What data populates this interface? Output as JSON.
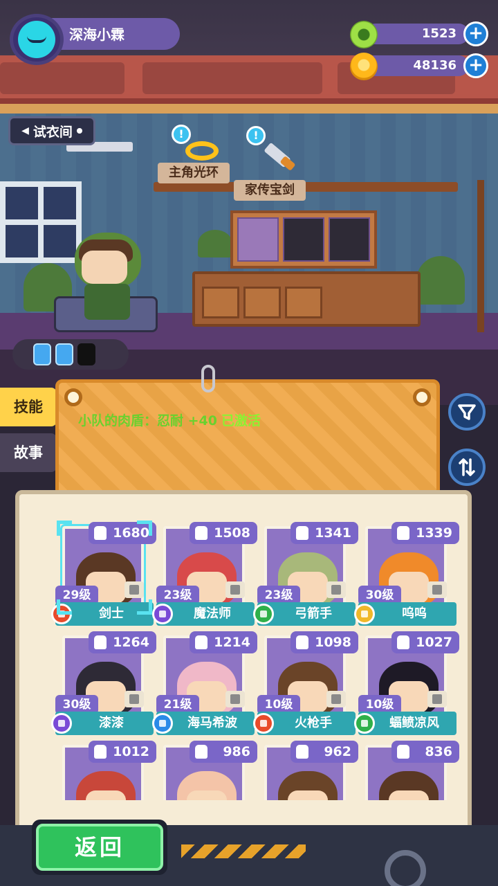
{
  "player": {
    "name": "深海小霖"
  },
  "currencies": [
    {
      "icon": "green-donut-currency-icon",
      "amount": "1523"
    },
    {
      "icon": "gold-planet-coin-icon",
      "amount": "48136"
    }
  ],
  "room": {
    "fitting_room_label": "试衣间",
    "halo_label": "主角光环",
    "sword_label": "家传宝剑",
    "alert_glyph": "!"
  },
  "side_tabs": [
    {
      "label": "技能",
      "active": true
    },
    {
      "label": "故事",
      "active": false
    }
  ],
  "info_board": {
    "skill_text": "小队的肉盾：忍耐 +40",
    "status_text": "已激活"
  },
  "characters": [
    {
      "name": "剑士",
      "level": "29级",
      "power": "1680",
      "class_color": "#e84a2a",
      "hair": "#5a3824",
      "bg": "#8e74c4",
      "selected": true
    },
    {
      "name": "魔法师",
      "level": "23级",
      "power": "1508",
      "class_color": "#7a4ad6",
      "hair": "#d84a4a",
      "bg": "#8e74c4",
      "selected": false
    },
    {
      "name": "弓箭手",
      "level": "23级",
      "power": "1341",
      "class_color": "#2fb04a",
      "hair": "#a8b87a",
      "bg": "#8e74c4",
      "selected": false
    },
    {
      "name": "呜呜",
      "level": "30级",
      "power": "1339",
      "class_color": "#f0b82a",
      "hair": "#f08a2a",
      "bg": "#8e74c4",
      "selected": false
    },
    {
      "name": "漆漆",
      "level": "30级",
      "power": "1264",
      "class_color": "#7a4ad6",
      "hair": "#2e2a36",
      "bg": "#8e74c4",
      "selected": false
    },
    {
      "name": "海马希波",
      "level": "21级",
      "power": "1214",
      "class_color": "#2a8ae8",
      "hair": "#f0b8c8",
      "bg": "#8e74c4",
      "selected": false
    },
    {
      "name": "火枪手",
      "level": "10级",
      "power": "1098",
      "class_color": "#e84a2a",
      "hair": "#6a4428",
      "bg": "#8e74c4",
      "selected": false
    },
    {
      "name": "蝠鲼凉风",
      "level": "10级",
      "power": "1027",
      "class_color": "#2fb04a",
      "hair": "#1e1a26",
      "bg": "#8e74c4",
      "selected": false
    },
    {
      "name": "",
      "level": "",
      "power": "1012",
      "class_color": "",
      "hair": "#c8473a",
      "bg": "#8e74c4",
      "selected": false,
      "partial": true
    },
    {
      "name": "",
      "level": "",
      "power": "986",
      "class_color": "",
      "hair": "#f4c4a8",
      "bg": "#8e74c4",
      "selected": false,
      "partial": true
    },
    {
      "name": "",
      "level": "",
      "power": "962",
      "class_color": "",
      "hair": "#6a4428",
      "bg": "#8e74c4",
      "selected": false,
      "partial": true
    },
    {
      "name": "",
      "level": "",
      "power": "836",
      "class_color": "",
      "hair": "#5a3824",
      "bg": "#8e74c4",
      "selected": false,
      "partial": true
    }
  ],
  "buttons": {
    "back_label": "返回",
    "filter_icon": "filter-funnel-icon",
    "sort_icon": "sort-swap-icon"
  }
}
